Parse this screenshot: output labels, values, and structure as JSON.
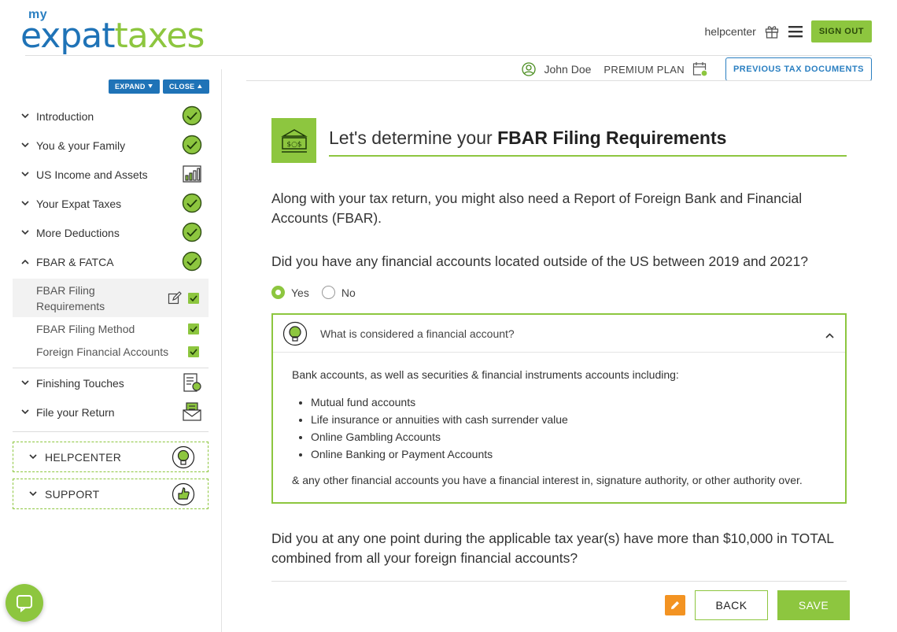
{
  "brand": {
    "my": "my",
    "expat": "expat",
    "taxes": "taxes",
    "primary_color": "#1f73b7",
    "accent_color": "#8dc63f"
  },
  "header": {
    "helpcenter": "helpcenter",
    "gift_icon": "gift-icon",
    "menu_icon": "hamburger-menu-icon",
    "sign_out": "SIGN OUT"
  },
  "userbar": {
    "user_name": "John Doe",
    "plan": "PREMIUM PLAN",
    "prev_docs": "PREVIOUS TAX DOCUMENTS"
  },
  "sidebar": {
    "expand": "EXPAND",
    "close": "CLOSE",
    "items": [
      {
        "label": "Introduction",
        "status": "complete"
      },
      {
        "label": "You & your Family",
        "status": "complete"
      },
      {
        "label": "US Income and Assets",
        "status": "chart-icon"
      },
      {
        "label": "Your Expat Taxes",
        "status": "complete"
      },
      {
        "label": "More Deductions",
        "status": "complete"
      },
      {
        "label": "FBAR & FATCA",
        "status": "complete"
      }
    ],
    "subitems": [
      {
        "line1": "FBAR Filing",
        "line2": "Requirements"
      },
      {
        "label": "FBAR Filing Method"
      },
      {
        "label": "Foreign Financial Accounts"
      }
    ],
    "after": [
      {
        "label": "Finishing Touches"
      },
      {
        "label": "File your Return"
      }
    ],
    "helpcenter": "HELPCENTER",
    "support": "SUPPORT"
  },
  "main": {
    "title_prefix": "Let's determine your ",
    "title_bold": "FBAR Filing Requirements",
    "intro": "Along with your tax return, you might also need a Report of Foreign Bank and Financial Accounts (FBAR).",
    "question1": "Did you have any financial accounts located outside of the US between 2019 and 2021?",
    "yes": "Yes",
    "no": "No",
    "selected": "Yes",
    "info_question": "What is considered a financial account?",
    "info_lead": "Bank accounts, as well as securities & financial instruments accounts including:",
    "info_list": [
      "Mutual fund accounts",
      "Life insurance or annuities with cash surrender value",
      "Online Gambling Accounts",
      "Online Banking or Payment Accounts"
    ],
    "info_tail": "& any other financial accounts you have a financial interest in, signature authority, or other authority over.",
    "question2": "Did you at any one point during the applicable tax year(s) have more than $10,000 in TOTAL combined from all your foreign financial accounts?"
  },
  "actions": {
    "back": "BACK",
    "save": "SAVE"
  }
}
